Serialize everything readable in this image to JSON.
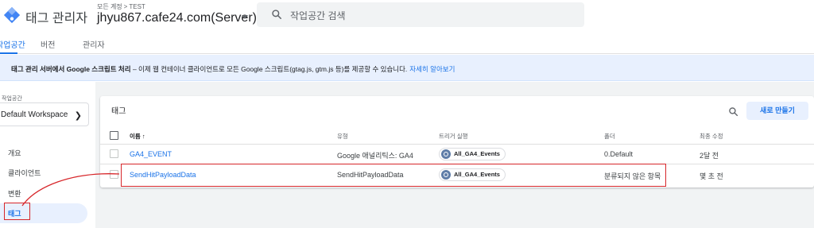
{
  "app": {
    "title": "태그 관리자",
    "breadcrumb_account": "모든 계정",
    "breadcrumb_sep": ">",
    "breadcrumb_container": "TEST",
    "container_name": "jhyu867.cafe24.com(Server)"
  },
  "search": {
    "placeholder": "작업공간 검색"
  },
  "tabs": [
    {
      "label": "작업공간"
    },
    {
      "label": "버전"
    },
    {
      "label": "관리자"
    }
  ],
  "banner": {
    "bold": "태그 관리 서버에서 Google 스크립트 처리",
    "text": " – 이제 웹 컨테이너 클라이언트로 모든 Google 스크립트(gtag.js, gtm.js 등)를 제공할 수 있습니다.",
    "link": "자세히 알아보기"
  },
  "sidebar": {
    "workspace_label": "작업공간",
    "workspace_name": "Default Workspace",
    "items": [
      {
        "label": "개요"
      },
      {
        "label": "클라이언트"
      },
      {
        "label": "변환"
      },
      {
        "label": "태그"
      }
    ]
  },
  "tags": {
    "title": "태그",
    "new_button": "새로 만들기",
    "columns": {
      "name": "이름 ↑",
      "type": "유형",
      "trigger": "트리거 실행",
      "folder": "폴더",
      "modified": "최종 수정"
    },
    "rows": [
      {
        "name": "GA4_EVENT",
        "type": "Google 애널리틱스: GA4",
        "trigger": "All_GA4_Events",
        "folder": "0.Default",
        "modified": "2달 전"
      },
      {
        "name": "SendHitPayloadData",
        "type": "SendHitPayloadData",
        "trigger": "All_GA4_Events",
        "folder": "분류되지 않은 항목",
        "modified": "몇 초 전"
      }
    ]
  },
  "colors": {
    "accent": "#1a73e8",
    "banner_bg": "#e8f0fe",
    "annotation": "#d7262a"
  }
}
